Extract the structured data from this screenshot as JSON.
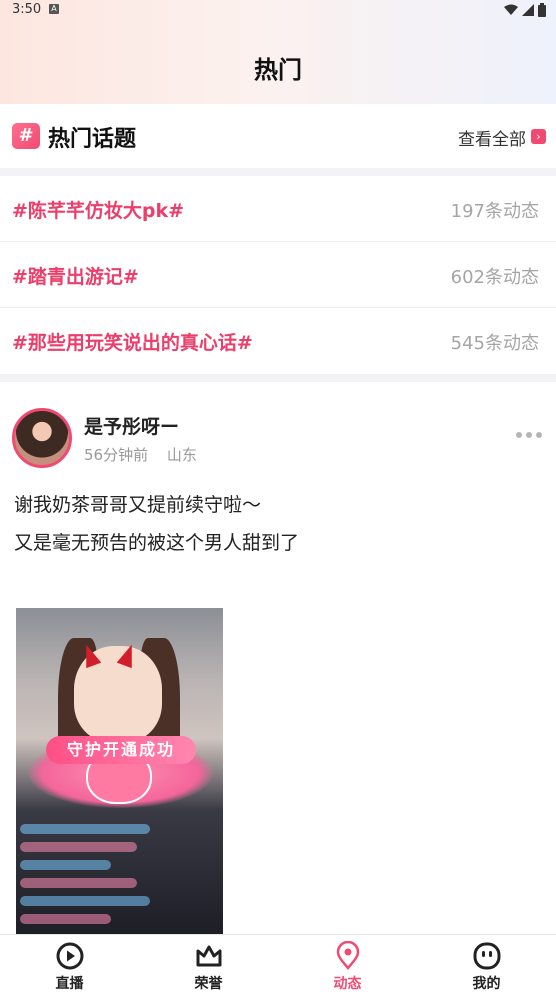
{
  "status_bar": {
    "time": "3:50",
    "notification_letter": "A"
  },
  "page_title": "热门",
  "hot_topics": {
    "title": "热门话题",
    "view_all_label": "查看全部",
    "items": [
      {
        "name": "#陈芊芊仿妆大pk#",
        "count": "197条动态"
      },
      {
        "name": "#踏青出游记#",
        "count": "602条动态"
      },
      {
        "name": "#那些用玩笑说出的真心话#",
        "count": "545条动态"
      }
    ]
  },
  "post": {
    "author": "是予彤呀ー",
    "time": "56分钟前",
    "location": "山东",
    "lines": [
      "谢我奶茶哥哥又提前续守啦～",
      "又是毫无预告的被这个男人甜到了"
    ],
    "image_banner_text": "守护开通成功"
  },
  "bottom_nav": {
    "active_index": 2,
    "accent_color": "#f14a72",
    "items": [
      {
        "label": "直播",
        "icon": "play-circle-icon"
      },
      {
        "label": "荣誉",
        "icon": "crown-icon"
      },
      {
        "label": "动态",
        "icon": "location-pin-icon"
      },
      {
        "label": "我的",
        "icon": "face-icon"
      }
    ]
  }
}
